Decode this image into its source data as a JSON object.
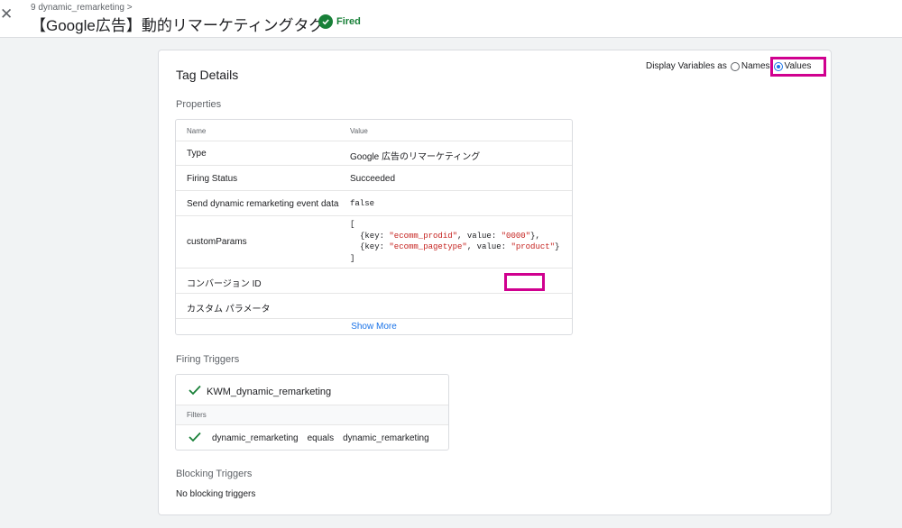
{
  "header": {
    "breadcrumb": "9 dynamic_remarketing >",
    "title": "【Google広告】動的リマーケティングタグ",
    "status": "Fired",
    "status_color": "#188038",
    "icons": [
      "close-icon",
      "check-circle-icon"
    ]
  },
  "card": {
    "title": "Tag Details",
    "display_variables": {
      "label": "Display Variables as",
      "options": [
        "Names",
        "Values"
      ],
      "selected": "Values"
    },
    "properties": {
      "section_label": "Properties",
      "columns": [
        "Name",
        "Value"
      ],
      "rows": [
        {
          "name": "Type",
          "value": "Google 広告のリマーケティング"
        },
        {
          "name": "Firing Status",
          "value": "Succeeded"
        },
        {
          "name": "Send dynamic remarketing event data",
          "value": "false"
        },
        {
          "name": "customParams",
          "value": ""
        },
        {
          "name": "コンバージョン ID",
          "value": ""
        },
        {
          "name": "カスタム パラメータ",
          "value": ""
        }
      ],
      "custom_params": {
        "open": "[",
        "close": "]",
        "line1_prefix": "{key: ",
        "line1_key": "\"ecomm_prodid\"",
        "line1_mid": ", value: ",
        "line1_value": "\"0000\"",
        "line1_end": "},",
        "line2_prefix": "{key: ",
        "line2_key": "\"ecomm_pagetype\"",
        "line2_mid": ", value: ",
        "line2_value": "\"product\"",
        "line2_end": "}"
      },
      "show_more": "Show More"
    },
    "firing_triggers": {
      "section_label": "Firing Triggers",
      "trigger_name": "KWM_dynamic_remarketing",
      "filters_label": "Filters",
      "filter": {
        "variable": "dynamic_remarketing",
        "operator": "equals",
        "value": "dynamic_remarketing"
      }
    },
    "blocking_triggers": {
      "section_label": "Blocking Triggers",
      "empty_text": "No blocking triggers"
    }
  },
  "highlight_color": "#d0008f"
}
